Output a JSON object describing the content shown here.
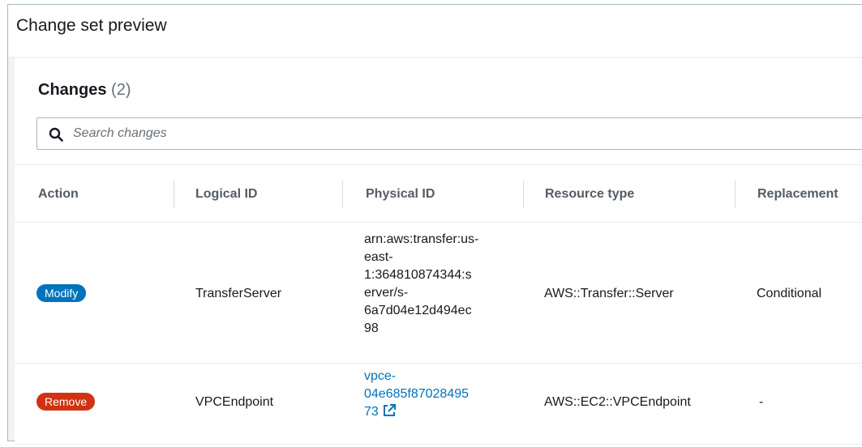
{
  "header": {
    "title": "Change set preview"
  },
  "changes": {
    "title": "Changes",
    "count": "(2)",
    "search_placeholder": "Search changes"
  },
  "table": {
    "columns": [
      "Action",
      "Logical ID",
      "Physical ID",
      "Resource type",
      "Replacement"
    ],
    "rows": [
      {
        "action": "Modify",
        "logical_id": "TransferServer",
        "physical_id_lines": [
          "arn:aws:transfer:us-",
          "east-",
          "1:364810874344:s",
          "erver/s-",
          "6a7d04e12d494ec",
          "98"
        ],
        "resource_type": "AWS::Transfer::Server",
        "replacement": "Conditional"
      },
      {
        "action": "Remove",
        "logical_id": "VPCEndpoint",
        "physical_id_lines": [
          "vpce-",
          "04e685f87028495",
          "73"
        ],
        "resource_type": "AWS::EC2::VPCEndpoint",
        "replacement": "-"
      }
    ]
  },
  "colors": {
    "modify_badge": "#0073bb",
    "remove_badge": "#d13212",
    "link": "#0073bb"
  },
  "icons": {
    "search": "search-icon",
    "external_link": "external-link-icon"
  }
}
